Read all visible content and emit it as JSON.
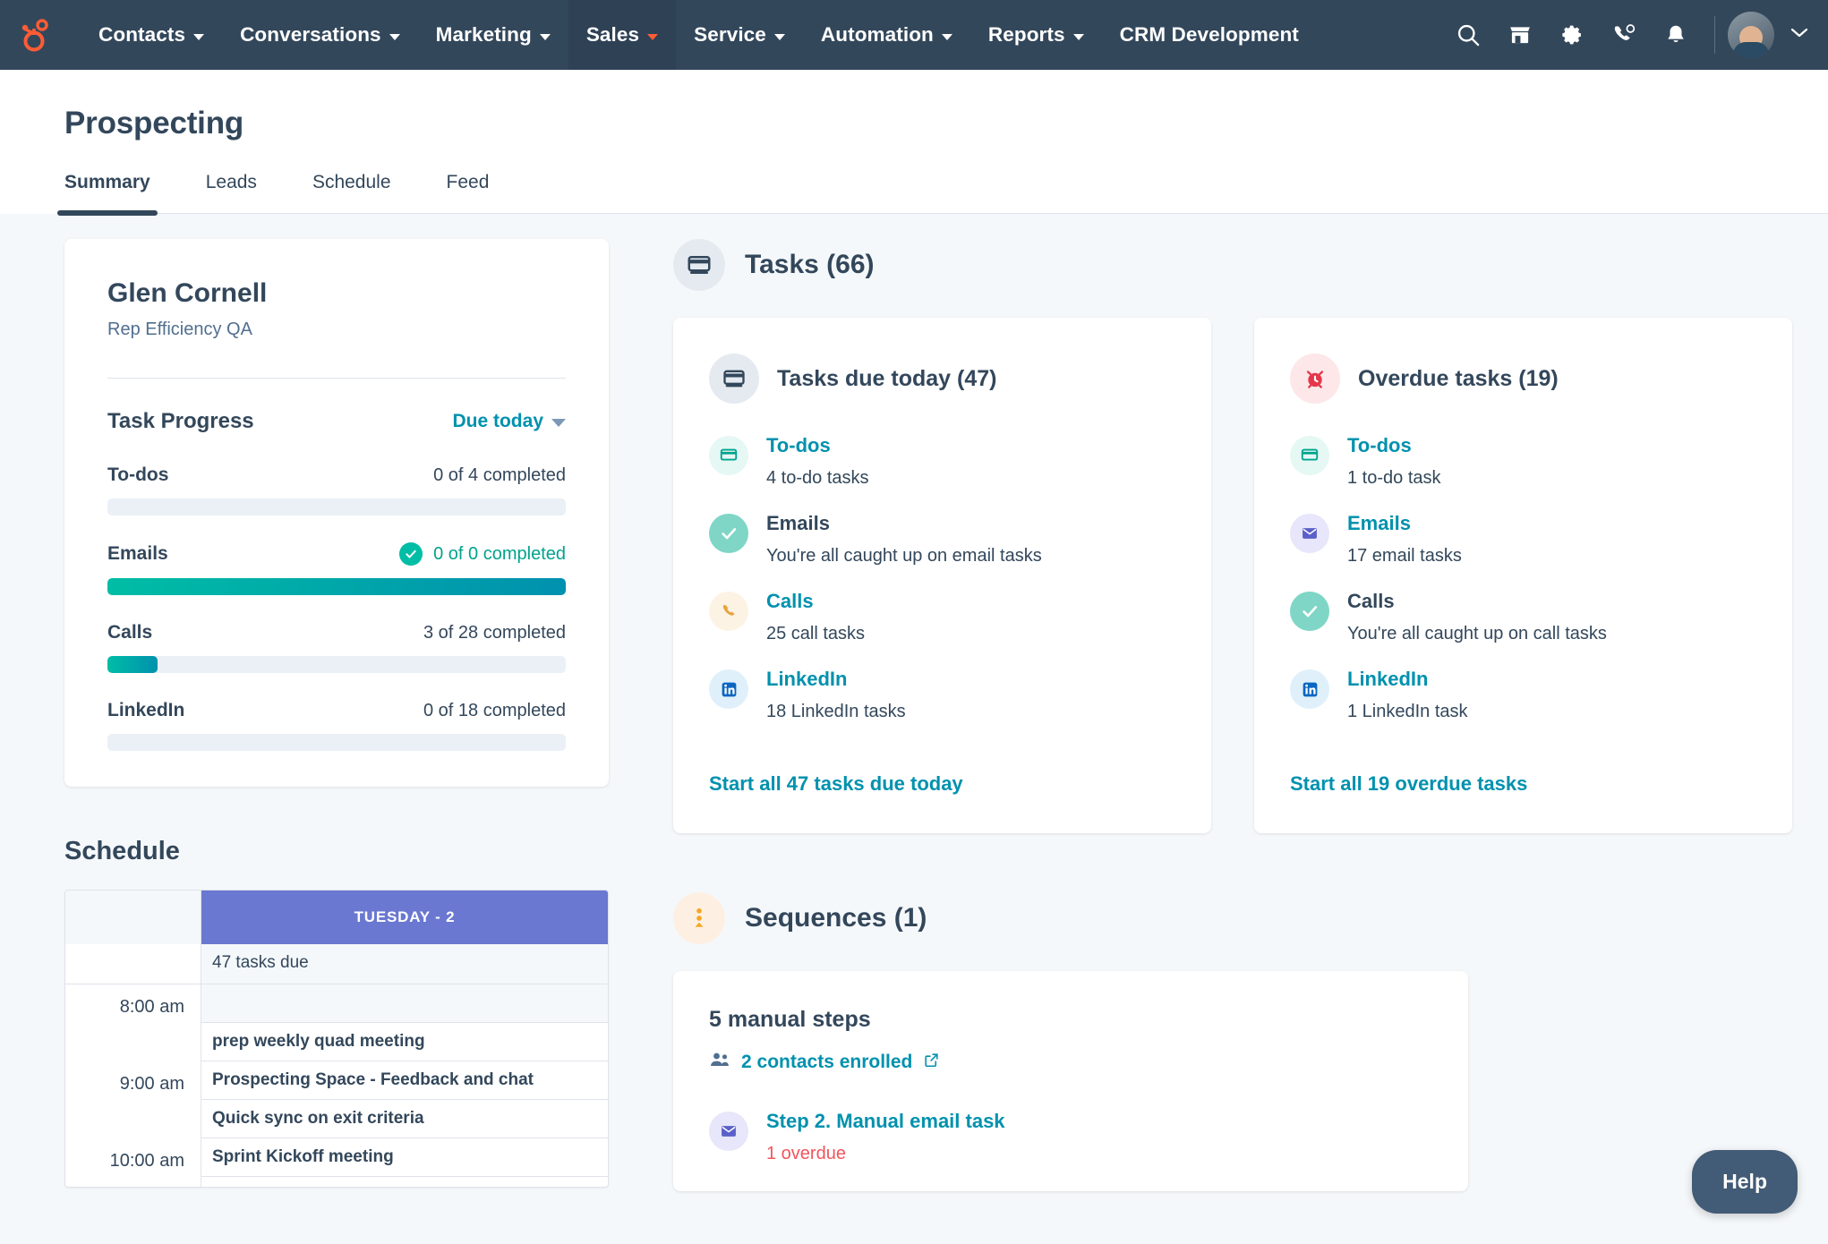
{
  "nav": {
    "logo": "hubspot-logo",
    "items": [
      {
        "label": "Contacts",
        "has_caret": true,
        "active": false
      },
      {
        "label": "Conversations",
        "has_caret": true,
        "active": false
      },
      {
        "label": "Marketing",
        "has_caret": true,
        "active": false
      },
      {
        "label": "Sales",
        "has_caret": true,
        "active": true
      },
      {
        "label": "Service",
        "has_caret": true,
        "active": false
      },
      {
        "label": "Automation",
        "has_caret": true,
        "active": false
      },
      {
        "label": "Reports",
        "has_caret": true,
        "active": false
      },
      {
        "label": "CRM Development",
        "has_caret": false,
        "active": false
      }
    ],
    "icons": [
      "search-icon",
      "marketplace-icon",
      "settings-gear-icon",
      "calling-icon",
      "notifications-bell-icon"
    ],
    "avatar": "user-avatar"
  },
  "page": {
    "title": "Prospecting",
    "tabs": [
      {
        "label": "Summary",
        "active": true
      },
      {
        "label": "Leads",
        "active": false
      },
      {
        "label": "Schedule",
        "active": false
      },
      {
        "label": "Feed",
        "active": false
      }
    ]
  },
  "rep": {
    "name": "Glen Cornell",
    "role": "Rep Efficiency QA",
    "progress_title": "Task Progress",
    "filter_label": "Due today",
    "rows": [
      {
        "label": "To-dos",
        "count": "0 of 4 completed",
        "percent": 0,
        "complete": false
      },
      {
        "label": "Emails",
        "count": "0 of 0 completed",
        "percent": 100,
        "complete": true
      },
      {
        "label": "Calls",
        "count": "3 of 28 completed",
        "percent": 11,
        "complete": false
      },
      {
        "label": "LinkedIn",
        "count": "0 of 18 completed",
        "percent": 0,
        "complete": false
      }
    ]
  },
  "schedule": {
    "title": "Schedule",
    "day_header": "TUESDAY - 2",
    "tasks_due": "47 tasks due",
    "rows": [
      {
        "time": "8:00 am",
        "events": [
          "",
          "prep weekly quad meeting"
        ]
      },
      {
        "time": "9:00 am",
        "events": [
          "Prospecting Space - Feedback and chat",
          "Quick sync on exit criteria"
        ]
      },
      {
        "time": "10:00 am",
        "events": [
          "Sprint Kickoff meeting"
        ]
      }
    ]
  },
  "tasks_section": {
    "icon": "tasks-icon",
    "title": "Tasks (66)",
    "cards": [
      {
        "icon": "tasks-icon",
        "title": "Tasks due today (47)",
        "rows": [
          {
            "icon": "todo-icon",
            "label": "To-dos",
            "sub": "4 to-do tasks",
            "is_link": true
          },
          {
            "icon": "check-icon",
            "label": "Emails",
            "sub": "You're all caught up on email tasks",
            "is_link": false
          },
          {
            "icon": "phone-icon",
            "label": "Calls",
            "sub": "25 call tasks",
            "is_link": true
          },
          {
            "icon": "linkedin-icon",
            "label": "LinkedIn",
            "sub": "18 LinkedIn tasks",
            "is_link": true
          }
        ],
        "start_all": "Start all 47 tasks due today"
      },
      {
        "icon": "overdue-alarm-icon",
        "title": "Overdue tasks (19)",
        "rows": [
          {
            "icon": "todo-icon",
            "label": "To-dos",
            "sub": "1 to-do task",
            "is_link": true
          },
          {
            "icon": "envelope-icon",
            "label": "Emails",
            "sub": "17 email tasks",
            "is_link": true
          },
          {
            "icon": "check-icon",
            "label": "Calls",
            "sub": "You're all caught up on call tasks",
            "is_link": false
          },
          {
            "icon": "linkedin-icon",
            "label": "LinkedIn",
            "sub": "1 LinkedIn task",
            "is_link": true
          }
        ],
        "start_all": "Start all 19 overdue tasks"
      }
    ]
  },
  "sequences_section": {
    "icon": "sequences-icon",
    "title": "Sequences (1)",
    "manual_steps": "5 manual steps",
    "contacts_enrolled": "2 contacts enrolled",
    "step": {
      "icon": "envelope-icon",
      "label": "Step 2. Manual email task",
      "overdue": "1 overdue"
    }
  },
  "help": {
    "label": "Help"
  },
  "colors": {
    "nav_bg": "#33475b",
    "accent_teal": "#0091ae",
    "progress_green": "#00bda5",
    "overdue_red": "#f2545b",
    "calendar_purple": "#6a78d1",
    "page_bg": "#f5f8fa"
  }
}
